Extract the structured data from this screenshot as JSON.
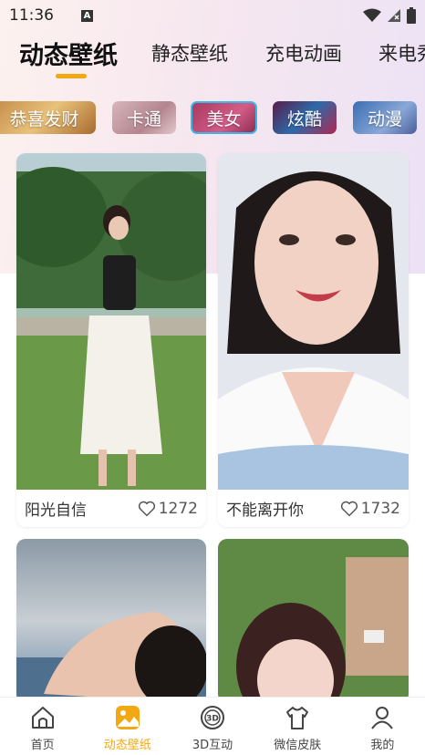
{
  "status_bar": {
    "time": "11:36",
    "notif_letter": "A"
  },
  "top_tabs": [
    {
      "label": "动态壁纸",
      "active": true
    },
    {
      "label": "静态壁纸",
      "active": false
    },
    {
      "label": "充电动画",
      "active": false
    },
    {
      "label": "来电秀",
      "active": false
    }
  ],
  "categories": [
    {
      "label": "恭喜发财",
      "active": false
    },
    {
      "label": "卡通",
      "active": false
    },
    {
      "label": "美女",
      "active": true
    },
    {
      "label": "炫酷",
      "active": false
    },
    {
      "label": "动漫",
      "active": false
    }
  ],
  "cards": [
    {
      "title": "阳光自信",
      "likes": "1272"
    },
    {
      "title": "不能离开你",
      "likes": "1732"
    },
    {
      "title": "",
      "likes": ""
    },
    {
      "title": "",
      "likes": ""
    }
  ],
  "bottom_nav": [
    {
      "label": "首页",
      "icon": "home-icon",
      "active": false
    },
    {
      "label": "动态壁纸",
      "icon": "dynamic-wallpaper-icon",
      "active": true
    },
    {
      "label": "3D互动",
      "icon": "3d-icon",
      "active": false
    },
    {
      "label": "微信皮肤",
      "icon": "shirt-icon",
      "active": false
    },
    {
      "label": "我的",
      "icon": "user-icon",
      "active": false
    }
  ],
  "colors": {
    "accent": "#f2a813",
    "active_cat_border": "#3bb8e8"
  }
}
